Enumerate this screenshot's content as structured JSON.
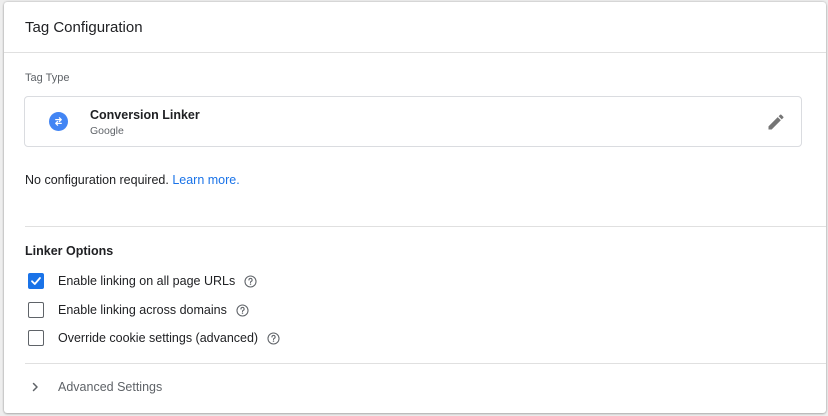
{
  "panel": {
    "title": "Tag Configuration",
    "tag_type_label": "Tag Type",
    "tag": {
      "name": "Conversion Linker",
      "vendor": "Google",
      "icon": "conversion-linker-icon"
    },
    "config_note": "No configuration required.",
    "learn_more": "Learn more."
  },
  "linker": {
    "title": "Linker Options",
    "options": [
      {
        "label": "Enable linking on all page URLs",
        "checked": true
      },
      {
        "label": "Enable linking across domains",
        "checked": false
      },
      {
        "label": "Override cookie settings (advanced)",
        "checked": false
      }
    ]
  },
  "advanced": {
    "label": "Advanced Settings"
  },
  "colors": {
    "accent": "#1a73e8",
    "icon_blue": "#4285f4"
  }
}
